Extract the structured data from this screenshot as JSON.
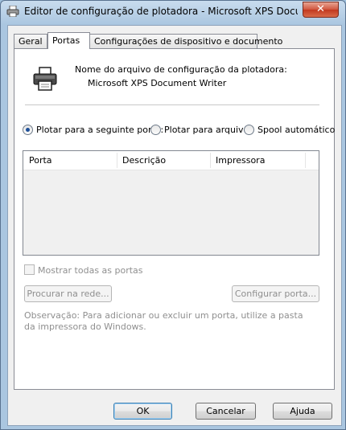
{
  "window": {
    "title": "Editor de configuração de plotadora - Microsoft XPS Document...",
    "close_label": "✕"
  },
  "tabs": [
    {
      "label": "Geral"
    },
    {
      "label": "Portas"
    },
    {
      "label": "Configurações de dispositivo e documento"
    }
  ],
  "active_tab": "Portas",
  "config": {
    "label": "Nome do arquivo de configuração da plotadora:",
    "value": "Microsoft XPS Document Writer"
  },
  "radios": [
    {
      "label": "Plotar para a seguinte porta:",
      "checked": true
    },
    {
      "label": "Plotar para arquivo",
      "checked": false
    },
    {
      "label": "Spool automático",
      "checked": false
    }
  ],
  "port_list": {
    "columns": [
      "Porta",
      "Descrição",
      "Impressora"
    ],
    "rows": []
  },
  "show_all_ports": {
    "label": "Mostrar todas as portas",
    "checked": false,
    "disabled": true
  },
  "buttons": {
    "browse": "Procurar na rede...",
    "configure": "Configurar porta...",
    "ok": "OK",
    "cancel": "Cancelar",
    "help": "Ajuda"
  },
  "note": "Observação: Para adicionar ou excluir um porta, utilize a pasta da impressora do Windows."
}
